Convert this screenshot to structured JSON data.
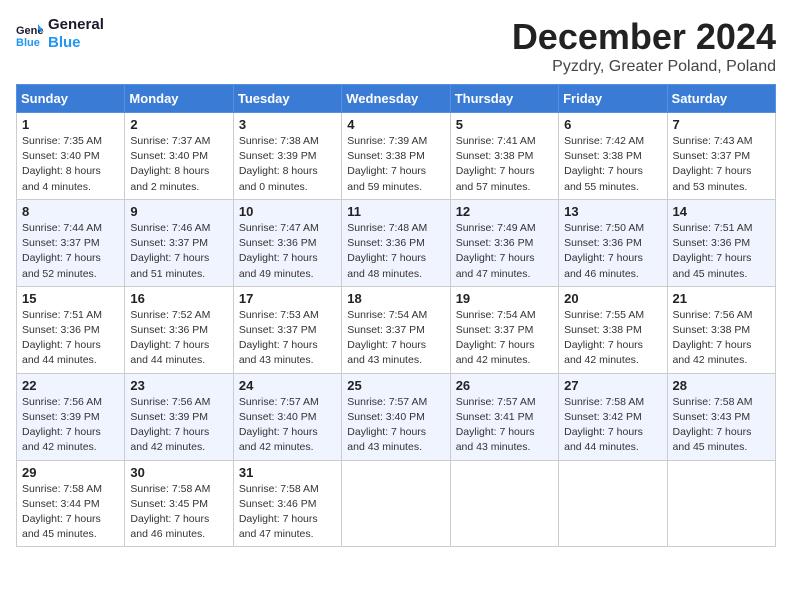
{
  "logo": {
    "line1": "General",
    "line2": "Blue"
  },
  "title": "December 2024",
  "subtitle": "Pyzdry, Greater Poland, Poland",
  "days_header": [
    "Sunday",
    "Monday",
    "Tuesday",
    "Wednesday",
    "Thursday",
    "Friday",
    "Saturday"
  ],
  "weeks": [
    [
      {
        "day": "1",
        "sunrise": "7:35 AM",
        "sunset": "3:40 PM",
        "daylight": "8 hours and 4 minutes."
      },
      {
        "day": "2",
        "sunrise": "7:37 AM",
        "sunset": "3:40 PM",
        "daylight": "8 hours and 2 minutes."
      },
      {
        "day": "3",
        "sunrise": "7:38 AM",
        "sunset": "3:39 PM",
        "daylight": "8 hours and 0 minutes."
      },
      {
        "day": "4",
        "sunrise": "7:39 AM",
        "sunset": "3:38 PM",
        "daylight": "7 hours and 59 minutes."
      },
      {
        "day": "5",
        "sunrise": "7:41 AM",
        "sunset": "3:38 PM",
        "daylight": "7 hours and 57 minutes."
      },
      {
        "day": "6",
        "sunrise": "7:42 AM",
        "sunset": "3:38 PM",
        "daylight": "7 hours and 55 minutes."
      },
      {
        "day": "7",
        "sunrise": "7:43 AM",
        "sunset": "3:37 PM",
        "daylight": "7 hours and 53 minutes."
      }
    ],
    [
      {
        "day": "8",
        "sunrise": "7:44 AM",
        "sunset": "3:37 PM",
        "daylight": "7 hours and 52 minutes."
      },
      {
        "day": "9",
        "sunrise": "7:46 AM",
        "sunset": "3:37 PM",
        "daylight": "7 hours and 51 minutes."
      },
      {
        "day": "10",
        "sunrise": "7:47 AM",
        "sunset": "3:36 PM",
        "daylight": "7 hours and 49 minutes."
      },
      {
        "day": "11",
        "sunrise": "7:48 AM",
        "sunset": "3:36 PM",
        "daylight": "7 hours and 48 minutes."
      },
      {
        "day": "12",
        "sunrise": "7:49 AM",
        "sunset": "3:36 PM",
        "daylight": "7 hours and 47 minutes."
      },
      {
        "day": "13",
        "sunrise": "7:50 AM",
        "sunset": "3:36 PM",
        "daylight": "7 hours and 46 minutes."
      },
      {
        "day": "14",
        "sunrise": "7:51 AM",
        "sunset": "3:36 PM",
        "daylight": "7 hours and 45 minutes."
      }
    ],
    [
      {
        "day": "15",
        "sunrise": "7:51 AM",
        "sunset": "3:36 PM",
        "daylight": "7 hours and 44 minutes."
      },
      {
        "day": "16",
        "sunrise": "7:52 AM",
        "sunset": "3:36 PM",
        "daylight": "7 hours and 44 minutes."
      },
      {
        "day": "17",
        "sunrise": "7:53 AM",
        "sunset": "3:37 PM",
        "daylight": "7 hours and 43 minutes."
      },
      {
        "day": "18",
        "sunrise": "7:54 AM",
        "sunset": "3:37 PM",
        "daylight": "7 hours and 43 minutes."
      },
      {
        "day": "19",
        "sunrise": "7:54 AM",
        "sunset": "3:37 PM",
        "daylight": "7 hours and 42 minutes."
      },
      {
        "day": "20",
        "sunrise": "7:55 AM",
        "sunset": "3:38 PM",
        "daylight": "7 hours and 42 minutes."
      },
      {
        "day": "21",
        "sunrise": "7:56 AM",
        "sunset": "3:38 PM",
        "daylight": "7 hours and 42 minutes."
      }
    ],
    [
      {
        "day": "22",
        "sunrise": "7:56 AM",
        "sunset": "3:39 PM",
        "daylight": "7 hours and 42 minutes."
      },
      {
        "day": "23",
        "sunrise": "7:56 AM",
        "sunset": "3:39 PM",
        "daylight": "7 hours and 42 minutes."
      },
      {
        "day": "24",
        "sunrise": "7:57 AM",
        "sunset": "3:40 PM",
        "daylight": "7 hours and 42 minutes."
      },
      {
        "day": "25",
        "sunrise": "7:57 AM",
        "sunset": "3:40 PM",
        "daylight": "7 hours and 43 minutes."
      },
      {
        "day": "26",
        "sunrise": "7:57 AM",
        "sunset": "3:41 PM",
        "daylight": "7 hours and 43 minutes."
      },
      {
        "day": "27",
        "sunrise": "7:58 AM",
        "sunset": "3:42 PM",
        "daylight": "7 hours and 44 minutes."
      },
      {
        "day": "28",
        "sunrise": "7:58 AM",
        "sunset": "3:43 PM",
        "daylight": "7 hours and 45 minutes."
      }
    ],
    [
      {
        "day": "29",
        "sunrise": "7:58 AM",
        "sunset": "3:44 PM",
        "daylight": "7 hours and 45 minutes."
      },
      {
        "day": "30",
        "sunrise": "7:58 AM",
        "sunset": "3:45 PM",
        "daylight": "7 hours and 46 minutes."
      },
      {
        "day": "31",
        "sunrise": "7:58 AM",
        "sunset": "3:46 PM",
        "daylight": "7 hours and 47 minutes."
      },
      null,
      null,
      null,
      null
    ]
  ]
}
